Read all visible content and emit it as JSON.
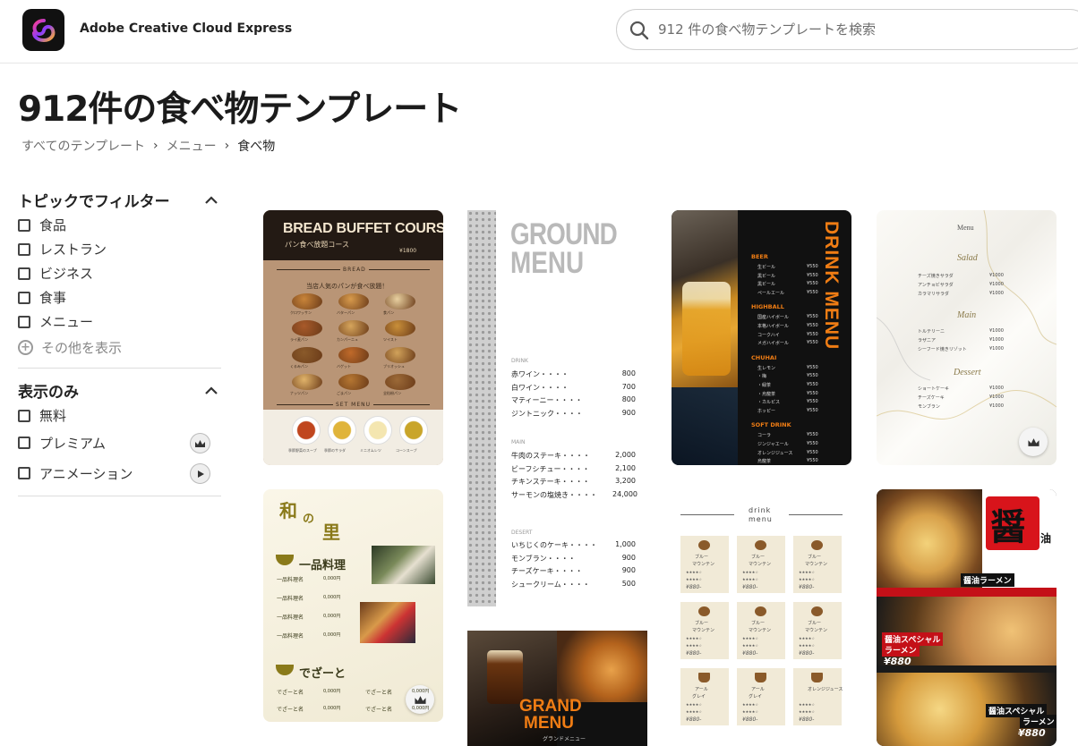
{
  "app": {
    "name": "Adobe Creative Cloud Express"
  },
  "search": {
    "placeholder": "912 件の食べ物テンプレートを検索"
  },
  "page": {
    "title": "912件の食べ物テンプレート"
  },
  "breadcrumb": [
    "すべてのテンプレート",
    "メニュー",
    "食べ物"
  ],
  "filters": {
    "topic": {
      "title": "トピックでフィルター",
      "items": [
        "食品",
        "レストラン",
        "ビジネス",
        "食事",
        "メニュー"
      ],
      "show_more": "その他を表示"
    },
    "show_only": {
      "title": "表示のみ",
      "items": [
        "無料",
        "プレミアム",
        "アニメーション"
      ]
    }
  },
  "templates": {
    "bread": {
      "title": "BREAD BUFFET COURSE",
      "subtitle": "パン食べ放題コース",
      "price": "¥1800",
      "section1": "BREAD",
      "lead": "当店人気のパンが食べ放題！",
      "breads": [
        "クロワッサン",
        "バターパン",
        "食パン",
        "ライ麦パン",
        "カンパーニュ",
        "ツイスト",
        "くるみパン",
        "バゲット",
        "ブリオッシュ",
        "ナッツパン",
        "ごまパン",
        "全粒粉パン"
      ],
      "section2": "SET MENU",
      "set": [
        "季節野菜のスープ",
        "季節のサラダ",
        "ミニオムレツ",
        "コーンスープ"
      ]
    },
    "ground": {
      "title1": "GROUND",
      "title2": "MENU",
      "drink_h": "DRINK",
      "drink": [
        [
          "赤ワイン・・・・",
          "800"
        ],
        [
          "白ワイン・・・・",
          "700"
        ],
        [
          "マティーニー・・・・",
          "800"
        ],
        [
          "ジントニック・・・・",
          "900"
        ]
      ],
      "main_h": "MAIN",
      "main": [
        [
          "牛肉のステーキ・・・・",
          "2,000"
        ],
        [
          "ビーフシチュー・・・・",
          "2,100"
        ],
        [
          "チキンステーキ・・・・",
          "3,200"
        ],
        [
          "サーモンの塩焼き・・・・",
          "24,000"
        ]
      ],
      "dessert_h": "DESERT",
      "dessert": [
        [
          "いちじくのケーキ・・・・",
          "1,000"
        ],
        [
          "モンブラン・・・・",
          "900"
        ],
        [
          "チーズケーキ・・・・",
          "900"
        ],
        [
          "シュークリーム・・・・",
          "500"
        ]
      ]
    },
    "drink": {
      "title": "DRINK MENU",
      "sections": [
        {
          "h": "BEER",
          "items": [
            "生ビール",
            "黒ビール",
            "黒ビール",
            "ペールエール"
          ]
        },
        {
          "h": "HIGHBALL",
          "items": [
            "国産ハイボール",
            "本格ハイボール",
            "コークハイ",
            "メガハイボール"
          ]
        },
        {
          "h": "CHUHAI",
          "items": [
            "生レモン",
            "・梅",
            "・緑茶",
            "・烏龍茶",
            "・カルピス",
            "ホッピー"
          ]
        },
        {
          "h": "SOFT DRINK",
          "items": [
            "コーラ",
            "ジンジャエール",
            "オレンジジュース",
            "烏龍茶"
          ]
        }
      ],
      "price": "¥550"
    },
    "marble": {
      "title": "Menu",
      "salad": "Salad",
      "salad_items": [
        "チーズ焼きサラダ",
        "アンチョビサラダ",
        "カラマリサラダ"
      ],
      "main": "Main",
      "main_items": [
        "トルテリーニ",
        "ラザニア",
        "シーフード焼きリゾット"
      ],
      "dessert": "Dessert",
      "dessert_items": [
        "ショートケーキ",
        "チーズケーキ",
        "モンブラン"
      ],
      "price": "¥1000"
    },
    "wa": {
      "c1": "和",
      "c2": "の",
      "c3": "里",
      "section1": "一品料理",
      "item": "一品料理名",
      "price": "0,000円",
      "section2": "でざーと",
      "d_item": "でざーと名"
    },
    "cafe": {
      "title1": "drink",
      "title2": "menu",
      "name1": "ブルー",
      "name2": "マウンテン",
      "name3": "アール",
      "name4": "グレイ",
      "name5": "オレンジジュース",
      "rate": "★★★★☆",
      "price": "¥880-"
    },
    "grand": {
      "title1": "GRAND",
      "title2": "MENU",
      "sub": "グランドメニュー"
    },
    "ramen": {
      "kanji": "醤",
      "kanji2": "油",
      "name1": "醤油ラーメン",
      "price1": "¥880",
      "name2": "醤油スペシャル",
      "name2b": "ラーメン",
      "price2": "¥880",
      "name3": "醤油スペシャル",
      "name3b": "ラーメン",
      "price3": "¥880"
    }
  },
  "colors": {
    "accent_orange": "#f07d14",
    "brown": "#b99576",
    "gold": "#8a7a1a"
  }
}
